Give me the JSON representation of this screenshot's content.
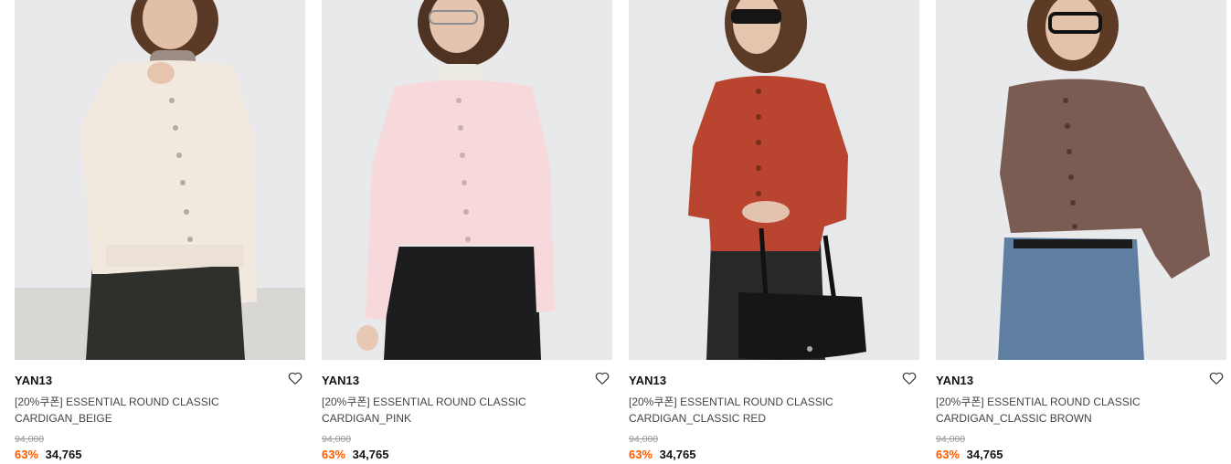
{
  "products": [
    {
      "brand": "YAN13",
      "name_line1": "[20%쿠폰] ESSENTIAL ROUND CLASSIC",
      "name_line2": "CARDIGAN_BEIGE",
      "original_price": "94,000",
      "discount": "63%",
      "price": "34,765",
      "color_hex": "#f1e8de",
      "icon": "heart-icon"
    },
    {
      "brand": "YAN13",
      "name_line1": "[20%쿠폰] ESSENTIAL ROUND CLASSIC",
      "name_line2": "CARDIGAN_PINK",
      "original_price": "94,000",
      "discount": "63%",
      "price": "34,765",
      "color_hex": "#f7d9db",
      "icon": "heart-icon"
    },
    {
      "brand": "YAN13",
      "name_line1": "[20%쿠폰] ESSENTIAL ROUND CLASSIC",
      "name_line2": "CARDIGAN_CLASSIC RED",
      "original_price": "94,000",
      "discount": "63%",
      "price": "34,765",
      "color_hex": "#b9442f",
      "icon": "heart-icon"
    },
    {
      "brand": "YAN13",
      "name_line1": "[20%쿠폰] ESSENTIAL ROUND CLASSIC",
      "name_line2": "CARDIGAN_CLASSIC BROWN",
      "original_price": "94,000",
      "discount": "63%",
      "price": "34,765",
      "color_hex": "#7b5c52",
      "icon": "heart-icon"
    }
  ],
  "accent_discount_color": "#ff5a00"
}
